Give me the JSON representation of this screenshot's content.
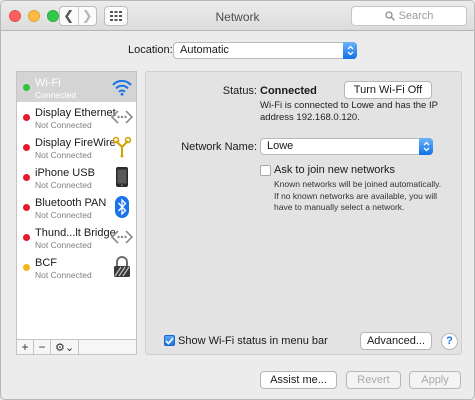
{
  "window": {
    "title": "Network"
  },
  "toolbar": {
    "back_glyph": "❮",
    "forward_glyph": "❯",
    "search_placeholder": "Search"
  },
  "location": {
    "label": "Location:",
    "value": "Automatic"
  },
  "services": [
    {
      "name": "Wi-Fi",
      "status": "Connected",
      "dot_color": "#2fc33a",
      "icon": "wifi-icon",
      "selected": true
    },
    {
      "name": "Display Ethernet",
      "status": "Not Connected",
      "dot_color": "#e5192a",
      "icon": "ethernet-icon"
    },
    {
      "name": "Display FireWire",
      "status": "Not Connected",
      "dot_color": "#e5192a",
      "icon": "firewire-icon"
    },
    {
      "name": "iPhone USB",
      "status": "Not Connected",
      "dot_color": "#e5192a",
      "icon": "iphone-icon"
    },
    {
      "name": "Bluetooth PAN",
      "status": "Not Connected",
      "dot_color": "#e5192a",
      "icon": "bluetooth-icon"
    },
    {
      "name": "Thund...lt Bridge",
      "status": "Not Connected",
      "dot_color": "#e5192a",
      "icon": "thunderbolt-bridge-icon"
    },
    {
      "name": "BCF",
      "status": "Not Connected",
      "dot_color": "#f4b41a",
      "icon": "vpn-lock-icon"
    }
  ],
  "sidebar_tools": {
    "add": "+",
    "remove": "−",
    "gear": "⚙⌄"
  },
  "detail": {
    "status_label": "Status:",
    "status_value": "Connected",
    "wifi_toggle_label": "Turn Wi-Fi Off",
    "status_description": "Wi-Fi is connected to Lowe and has the IP address 192.168.0.120.",
    "network_name_label": "Network Name:",
    "network_name_value": "Lowe",
    "ask_join_label": "Ask to join new networks",
    "ask_join_checked": false,
    "ask_join_description": "Known networks will be joined automatically. If no known networks are available, you will have to manually select a network.",
    "show_status_label": "Show Wi-Fi status in menu bar",
    "show_status_checked": true,
    "advanced_label": "Advanced...",
    "help_label": "?"
  },
  "footer": {
    "assist_label": "Assist me...",
    "revert_label": "Revert",
    "apply_label": "Apply"
  },
  "colors": {
    "accent": "#1a73e8",
    "selection": "#d4d4d4"
  }
}
